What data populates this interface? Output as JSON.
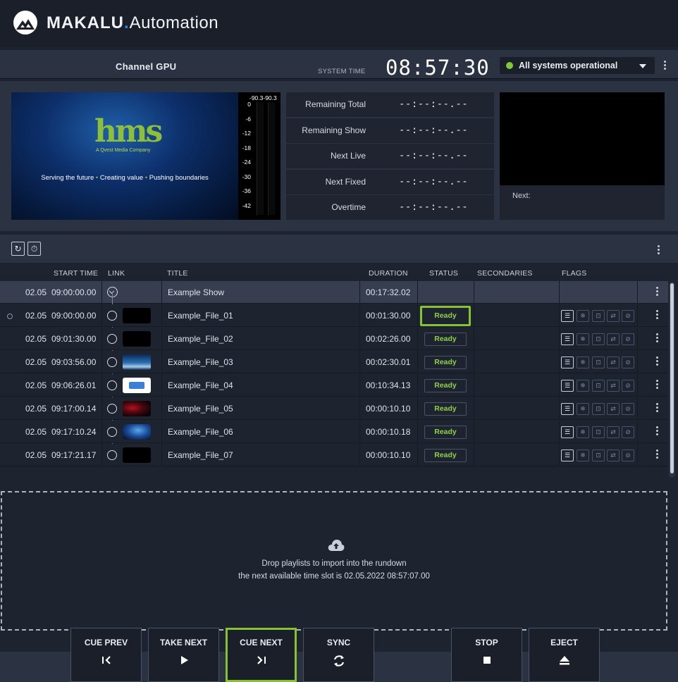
{
  "app": {
    "brand_main": "MAKALU",
    "brand_dot": ".",
    "brand_sub": "Automation"
  },
  "channel": {
    "title": "Channel GPU",
    "system_time_label": "SYSTEM TIME",
    "clock": "08:57:30",
    "status": "All systems operational"
  },
  "preview": {
    "logo_text": "hms",
    "logo_sub": "A Qvest Media Company",
    "tagline_parts": [
      "Serving the future",
      "Creating value",
      "Pushing boundaries"
    ],
    "tagline_sep": "•",
    "meter_top": "-90.3-90.3",
    "meter_ticks": [
      "0",
      "-6",
      "-12",
      "-18",
      "-24",
      "-30",
      "-36",
      "-42"
    ]
  },
  "timers": [
    {
      "label": "Remaining Total",
      "value": "--:--:--.--"
    },
    {
      "label": "Remaining Show",
      "value": "--:--:--.--"
    },
    {
      "label": "Next Live",
      "value": "--:--:--.--"
    },
    {
      "label": "Next Fixed",
      "value": "--:--:--.--"
    },
    {
      "label": "Overtime",
      "value": "--:--:--.--"
    }
  ],
  "next_pane": {
    "label": "Next:"
  },
  "table": {
    "columns": {
      "start_time": "START TIME",
      "link": "LINK",
      "title": "TITLE",
      "duration": "DURATION",
      "status": "STATUS",
      "secondaries": "SECONDARIES",
      "flags": "FLAGS"
    },
    "show": {
      "date": "02.05",
      "time": "09:00:00.00",
      "title": "Example Show",
      "duration": "00:17:32.02"
    },
    "rows": [
      {
        "date": "02.05",
        "time": "09:00:00.00",
        "title": "Example_File_01",
        "duration": "00:01:30.00",
        "status": "Ready"
      },
      {
        "date": "02.05",
        "time": "09:01:30.00",
        "title": "Example_File_02",
        "duration": "00:02:26.00",
        "status": "Ready"
      },
      {
        "date": "02.05",
        "time": "09:03:56.00",
        "title": "Example_File_03",
        "duration": "00:02:30.01",
        "status": "Ready"
      },
      {
        "date": "02.05",
        "time": "09:06:26.01",
        "title": "Example_File_04",
        "duration": "00:10:34.13",
        "status": "Ready"
      },
      {
        "date": "02.05",
        "time": "09:17:00.14",
        "title": "Example_File_05",
        "duration": "00:00:10.10",
        "status": "Ready"
      },
      {
        "date": "02.05",
        "time": "09:17:10.24",
        "title": "Example_File_06",
        "duration": "00:00:10.18",
        "status": "Ready"
      },
      {
        "date": "02.05",
        "time": "09:17:21.17",
        "title": "Example_File_07",
        "duration": "00:00:10.10",
        "status": "Ready"
      }
    ]
  },
  "dropzone": {
    "line1": "Drop playlists to import into the rundown",
    "line2": "the next available time slot is 02.05.2022 08:57:07.00"
  },
  "controls": {
    "cue_prev": "CUE PREV",
    "take_next": "TAKE NEXT",
    "cue_next": "CUE NEXT",
    "sync": "SYNC",
    "stop": "STOP",
    "eject": "EJECT"
  },
  "colors": {
    "accent_green": "#86c232",
    "ready_green": "#8fd04a",
    "brand_blue": "#2a86e8",
    "panel": "#2b3241",
    "background": "#1e2330"
  }
}
